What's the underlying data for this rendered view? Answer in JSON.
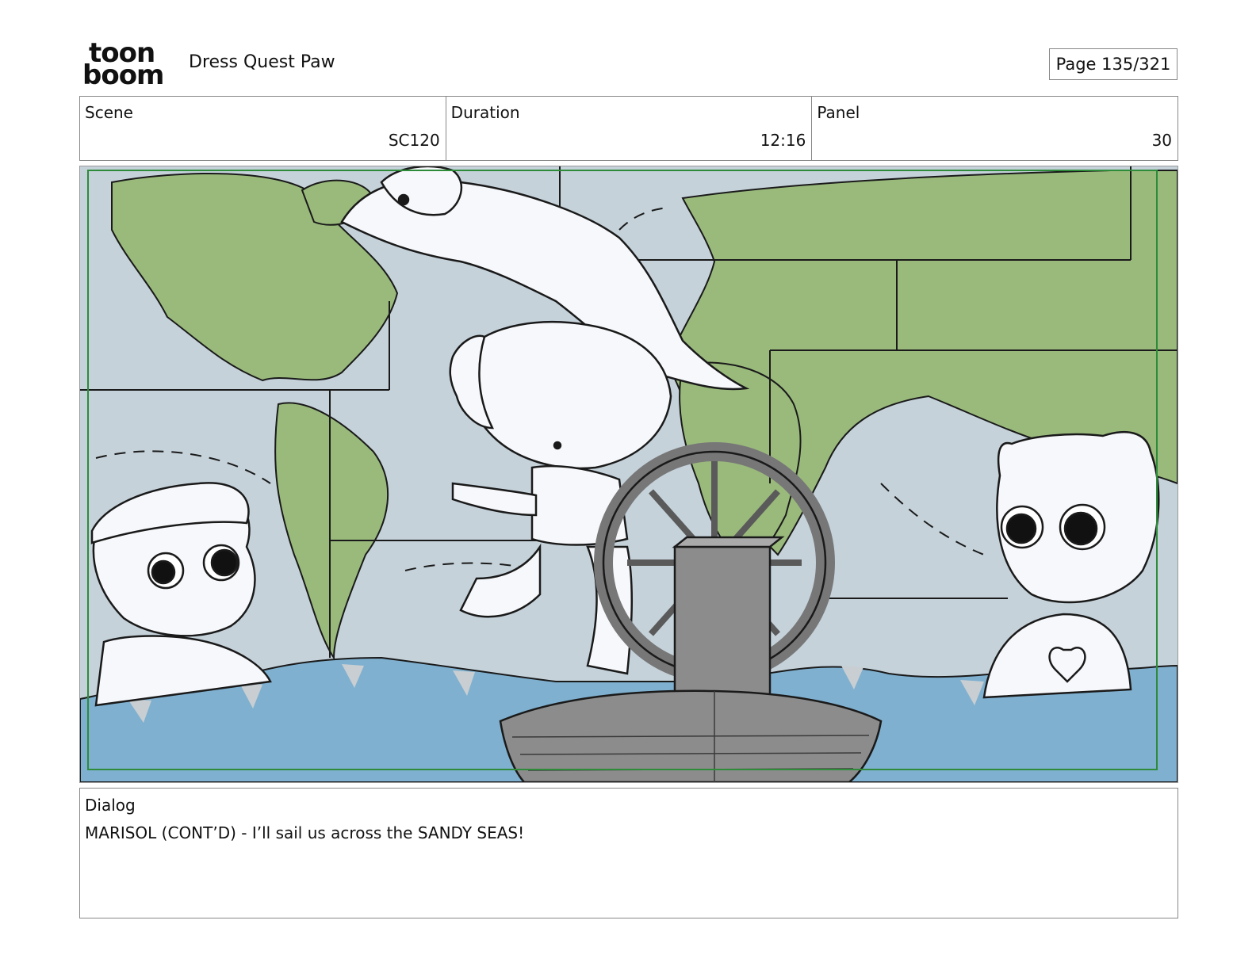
{
  "header": {
    "logo": {
      "line1": "toon",
      "line2": "boom",
      "icon": "toon-boom-logo-icon"
    },
    "project_title": "Dress Quest Paw",
    "page_indicator": "Page 135/321"
  },
  "info": {
    "scene": {
      "label": "Scene",
      "value": "SC120"
    },
    "duration": {
      "label": "Duration",
      "value": "12:16"
    },
    "panel": {
      "label": "Panel",
      "value": "30"
    }
  },
  "artwork": {
    "description_icon": "storyboard-panel-image",
    "colors": {
      "land": "#9aba7c",
      "ocean": "#c5d2da",
      "sea": "#7fb0cf",
      "boat": "#8c8c8c",
      "frame": "#2e8b3a"
    }
  },
  "dialog": {
    "label": "Dialog",
    "text": "MARISOL (CONT’D) - I’ll sail us across the SANDY SEAS!"
  }
}
